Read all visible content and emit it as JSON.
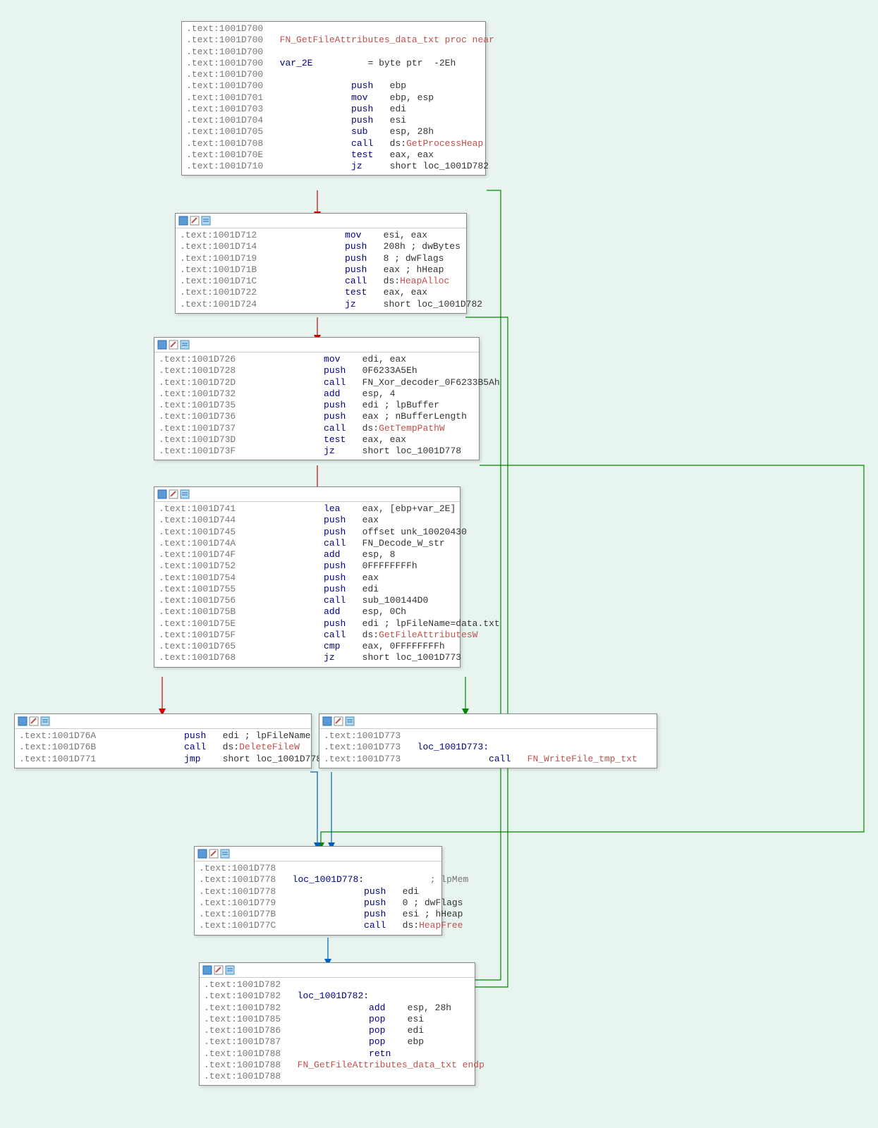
{
  "blocks": {
    "b1": {
      "lines": [
        {
          "addr": ".text:1001D700",
          "rest": ""
        },
        {
          "addr": ".text:1001D700",
          "sym": "FN_GetFileAttributes_data_txt proc near"
        },
        {
          "addr": ".text:1001D700",
          "rest": ""
        },
        {
          "addr": ".text:1001D700",
          "var": "var_2E",
          "rest": "= byte ptr  -2Eh"
        },
        {
          "addr": ".text:1001D700",
          "rest": ""
        },
        {
          "addr": ".text:1001D700",
          "mnem": "push",
          "ops": "ebp"
        },
        {
          "addr": ".text:1001D701",
          "mnem": "mov",
          "ops": "ebp, esp"
        },
        {
          "addr": ".text:1001D703",
          "mnem": "push",
          "ops": "edi"
        },
        {
          "addr": ".text:1001D704",
          "mnem": "push",
          "ops": "esi"
        },
        {
          "addr": ".text:1001D705",
          "mnem": "sub",
          "ops": "esp, 28h"
        },
        {
          "addr": ".text:1001D708",
          "mnem": "call",
          "ops": "ds:",
          "symop": "GetProcessHeap"
        },
        {
          "addr": ".text:1001D70E",
          "mnem": "test",
          "ops": "eax, eax"
        },
        {
          "addr": ".text:1001D710",
          "mnem": "jz",
          "ops": "short loc_1001D782"
        }
      ]
    },
    "b2": {
      "lines": [
        {
          "addr": ".text:1001D712",
          "mnem": "mov",
          "ops": "esi, eax"
        },
        {
          "addr": ".text:1001D714",
          "mnem": "push",
          "ops": "208h ; dwBytes"
        },
        {
          "addr": ".text:1001D719",
          "mnem": "push",
          "ops": "8 ; dwFlags"
        },
        {
          "addr": ".text:1001D71B",
          "mnem": "push",
          "ops": "eax ; hHeap"
        },
        {
          "addr": ".text:1001D71C",
          "mnem": "call",
          "ops": "ds:",
          "symop": "HeapAlloc"
        },
        {
          "addr": ".text:1001D722",
          "mnem": "test",
          "ops": "eax, eax"
        },
        {
          "addr": ".text:1001D724",
          "mnem": "jz",
          "ops": "short loc_1001D782"
        }
      ]
    },
    "b3": {
      "lines": [
        {
          "addr": ".text:1001D726",
          "mnem": "mov",
          "ops": "edi, eax"
        },
        {
          "addr": ".text:1001D728",
          "mnem": "push",
          "ops": "0F6233A5Eh"
        },
        {
          "addr": ".text:1001D72D",
          "mnem": "call",
          "ops": "FN_Xor_decoder_0F6233B5Ah"
        },
        {
          "addr": ".text:1001D732",
          "mnem": "add",
          "ops": "esp, 4"
        },
        {
          "addr": ".text:1001D735",
          "mnem": "push",
          "ops": "edi ; lpBuffer"
        },
        {
          "addr": ".text:1001D736",
          "mnem": "push",
          "ops": "eax ; nBufferLength"
        },
        {
          "addr": ".text:1001D737",
          "mnem": "call",
          "ops": "ds:",
          "symop": "GetTempPathW"
        },
        {
          "addr": ".text:1001D73D",
          "mnem": "test",
          "ops": "eax, eax"
        },
        {
          "addr": ".text:1001D73F",
          "mnem": "jz",
          "ops": "short loc_1001D778"
        }
      ]
    },
    "b4": {
      "lines": [
        {
          "addr": ".text:1001D741",
          "mnem": "lea",
          "ops": "eax, [ebp+var_2E]"
        },
        {
          "addr": ".text:1001D744",
          "mnem": "push",
          "ops": "eax"
        },
        {
          "addr": ".text:1001D745",
          "mnem": "push",
          "ops": "offset unk_10020430"
        },
        {
          "addr": ".text:1001D74A",
          "mnem": "call",
          "ops": "FN_Decode_W_str"
        },
        {
          "addr": ".text:1001D74F",
          "mnem": "add",
          "ops": "esp, 8"
        },
        {
          "addr": ".text:1001D752",
          "mnem": "push",
          "ops": "0FFFFFFFFh"
        },
        {
          "addr": ".text:1001D754",
          "mnem": "push",
          "ops": "eax"
        },
        {
          "addr": ".text:1001D755",
          "mnem": "push",
          "ops": "edi"
        },
        {
          "addr": ".text:1001D756",
          "mnem": "call",
          "ops": "sub_100144D0"
        },
        {
          "addr": ".text:1001D75B",
          "mnem": "add",
          "ops": "esp, 0Ch"
        },
        {
          "addr": ".text:1001D75E",
          "mnem": "push",
          "ops": "edi ; lpFileName=data.txt"
        },
        {
          "addr": ".text:1001D75F",
          "mnem": "call",
          "ops": "ds:",
          "symop": "GetFileAttributesW"
        },
        {
          "addr": ".text:1001D765",
          "mnem": "cmp",
          "ops": "eax, 0FFFFFFFFh"
        },
        {
          "addr": ".text:1001D768",
          "mnem": "jz",
          "ops": "short loc_1001D773"
        }
      ]
    },
    "b5": {
      "lines": [
        {
          "addr": ".text:1001D76A",
          "mnem": "push",
          "ops": "edi ; lpFileName"
        },
        {
          "addr": ".text:1001D76B",
          "mnem": "call",
          "ops": "ds:",
          "symop": "DeleteFileW"
        },
        {
          "addr": ".text:1001D771",
          "mnem": "jmp",
          "ops": "short loc_1001D778"
        }
      ]
    },
    "b6": {
      "lines": [
        {
          "addr": ".text:1001D773",
          "rest": ""
        },
        {
          "addr": ".text:1001D773",
          "label": "loc_1001D773:"
        },
        {
          "addr": ".text:1001D773",
          "mnem": "call",
          "ops": "",
          "symop": "FN_WriteFile_tmp_txt"
        }
      ]
    },
    "b7": {
      "lines": [
        {
          "addr": ".text:1001D778",
          "rest": ""
        },
        {
          "addr": ".text:1001D778",
          "label": "loc_1001D778:",
          "comm": "; lpMem"
        },
        {
          "addr": ".text:1001D778",
          "mnem": "push",
          "ops": "edi"
        },
        {
          "addr": ".text:1001D779",
          "mnem": "push",
          "ops": "0 ; dwFlags"
        },
        {
          "addr": ".text:1001D77B",
          "mnem": "push",
          "ops": "esi ; hHeap"
        },
        {
          "addr": ".text:1001D77C",
          "mnem": "call",
          "ops": "ds:",
          "symop": "HeapFree"
        }
      ]
    },
    "b8": {
      "lines": [
        {
          "addr": ".text:1001D782",
          "rest": ""
        },
        {
          "addr": ".text:1001D782",
          "label": "loc_1001D782:"
        },
        {
          "addr": ".text:1001D782",
          "mnem": "add",
          "ops": "esp, 28h"
        },
        {
          "addr": ".text:1001D785",
          "mnem": "pop",
          "ops": "esi"
        },
        {
          "addr": ".text:1001D786",
          "mnem": "pop",
          "ops": "edi"
        },
        {
          "addr": ".text:1001D787",
          "mnem": "pop",
          "ops": "ebp"
        },
        {
          "addr": ".text:1001D788",
          "mnem": "retn",
          "ops": ""
        },
        {
          "addr": ".text:1001D788",
          "sym": "FN_GetFileAttributes_data_txt endp"
        },
        {
          "addr": ".text:1001D788",
          "rest": ""
        }
      ]
    }
  },
  "icon_names": [
    "graph-view-icon",
    "edit-icon",
    "list-icon"
  ]
}
